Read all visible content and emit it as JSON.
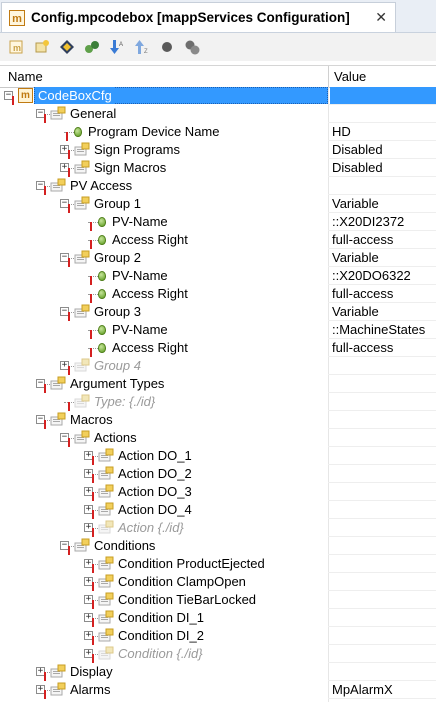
{
  "tab": {
    "title": "Config.mpcodebox [mappServices Configuration]",
    "icon_label": "m",
    "close_glyph": "✕"
  },
  "toolbar": {
    "buttons": [
      "new-object-icon",
      "add-element-icon",
      "move-icon",
      "link-icon",
      "sort-desc-icon",
      "sort-asc-icon",
      "record-icon",
      "settings-icon"
    ]
  },
  "columns": {
    "name": "Name",
    "value": "Value"
  },
  "tree": [
    {
      "label": "CodeBoxCfg",
      "value": "",
      "depth": 0,
      "kind": "root",
      "expander": "minus",
      "selected": true
    },
    {
      "label": "General",
      "value": "",
      "depth": 1,
      "kind": "group",
      "expander": "minus"
    },
    {
      "label": "Program Device Name",
      "value": "HD",
      "depth": 2,
      "kind": "param",
      "expander": ""
    },
    {
      "label": "Sign Programs",
      "value": "Disabled",
      "depth": 2,
      "kind": "group",
      "expander": "plus"
    },
    {
      "label": "Sign Macros",
      "value": "Disabled",
      "depth": 2,
      "kind": "group",
      "expander": "plus"
    },
    {
      "label": "PV Access",
      "value": "",
      "depth": 1,
      "kind": "group",
      "expander": "minus"
    },
    {
      "label": "Group 1",
      "value": "Variable",
      "depth": 2,
      "kind": "group",
      "expander": "minus"
    },
    {
      "label": "PV-Name",
      "value": "::X20DI2372",
      "depth": 3,
      "kind": "param",
      "expander": ""
    },
    {
      "label": "Access Right",
      "value": "full-access",
      "depth": 3,
      "kind": "param",
      "expander": ""
    },
    {
      "label": "Group 2",
      "value": "Variable",
      "depth": 2,
      "kind": "group",
      "expander": "minus"
    },
    {
      "label": "PV-Name",
      "value": "::X20DO6322",
      "depth": 3,
      "kind": "param",
      "expander": ""
    },
    {
      "label": "Access Right",
      "value": "full-access",
      "depth": 3,
      "kind": "param",
      "expander": ""
    },
    {
      "label": "Group 3",
      "value": "Variable",
      "depth": 2,
      "kind": "group",
      "expander": "minus"
    },
    {
      "label": "PV-Name",
      "value": "::MachineStates",
      "depth": 3,
      "kind": "param",
      "expander": ""
    },
    {
      "label": "Access Right",
      "value": "full-access",
      "depth": 3,
      "kind": "param",
      "expander": ""
    },
    {
      "label": "Group 4",
      "value": "",
      "depth": 2,
      "kind": "ghost",
      "expander": "plus"
    },
    {
      "label": "Argument Types",
      "value": "",
      "depth": 1,
      "kind": "group",
      "expander": "minus"
    },
    {
      "label": "Type: {./id}",
      "value": "",
      "depth": 2,
      "kind": "ghost",
      "expander": ""
    },
    {
      "label": "Macros",
      "value": "",
      "depth": 1,
      "kind": "group",
      "expander": "minus"
    },
    {
      "label": "Actions",
      "value": "",
      "depth": 2,
      "kind": "group",
      "expander": "minus"
    },
    {
      "label": "Action DO_1",
      "value": "",
      "depth": 3,
      "kind": "group",
      "expander": "plus"
    },
    {
      "label": "Action DO_2",
      "value": "",
      "depth": 3,
      "kind": "group",
      "expander": "plus"
    },
    {
      "label": "Action DO_3",
      "value": "",
      "depth": 3,
      "kind": "group",
      "expander": "plus"
    },
    {
      "label": "Action DO_4",
      "value": "",
      "depth": 3,
      "kind": "group",
      "expander": "plus"
    },
    {
      "label": "Action {./id}",
      "value": "",
      "depth": 3,
      "kind": "ghost",
      "expander": "plus"
    },
    {
      "label": "Conditions",
      "value": "",
      "depth": 2,
      "kind": "group",
      "expander": "minus"
    },
    {
      "label": "Condition ProductEjected",
      "value": "",
      "depth": 3,
      "kind": "group",
      "expander": "plus"
    },
    {
      "label": "Condition ClampOpen",
      "value": "",
      "depth": 3,
      "kind": "group",
      "expander": "plus"
    },
    {
      "label": "Condition TieBarLocked",
      "value": "",
      "depth": 3,
      "kind": "group",
      "expander": "plus"
    },
    {
      "label": "Condition DI_1",
      "value": "",
      "depth": 3,
      "kind": "group",
      "expander": "plus"
    },
    {
      "label": "Condition DI_2",
      "value": "",
      "depth": 3,
      "kind": "group",
      "expander": "plus"
    },
    {
      "label": "Condition {./id}",
      "value": "",
      "depth": 3,
      "kind": "ghost",
      "expander": "plus"
    },
    {
      "label": "Display",
      "value": "",
      "depth": 1,
      "kind": "group",
      "expander": "plus"
    },
    {
      "label": "Alarms",
      "value": "MpAlarmX",
      "depth": 1,
      "kind": "group",
      "expander": "plus"
    }
  ]
}
